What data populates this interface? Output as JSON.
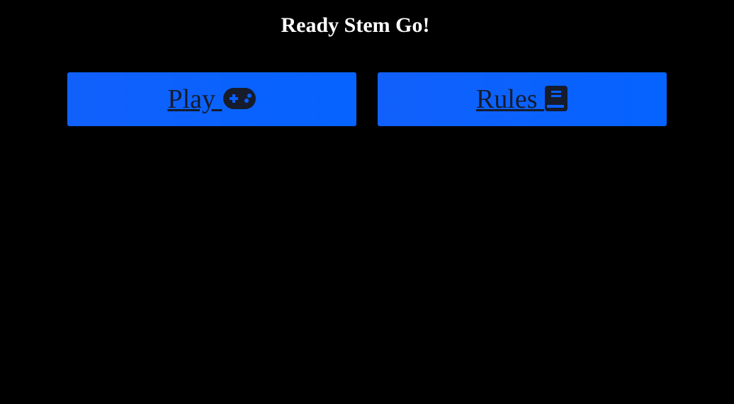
{
  "page": {
    "title": "Ready Stem Go!"
  },
  "buttons": {
    "play": {
      "label": "Play ",
      "icon": "gamepad-icon"
    },
    "rules": {
      "label": "Rules ",
      "icon": "book-icon"
    }
  },
  "colors": {
    "background": "#000000",
    "button": "#0563ff",
    "button_text": "#161c2c",
    "title_text": "#ffffff"
  }
}
